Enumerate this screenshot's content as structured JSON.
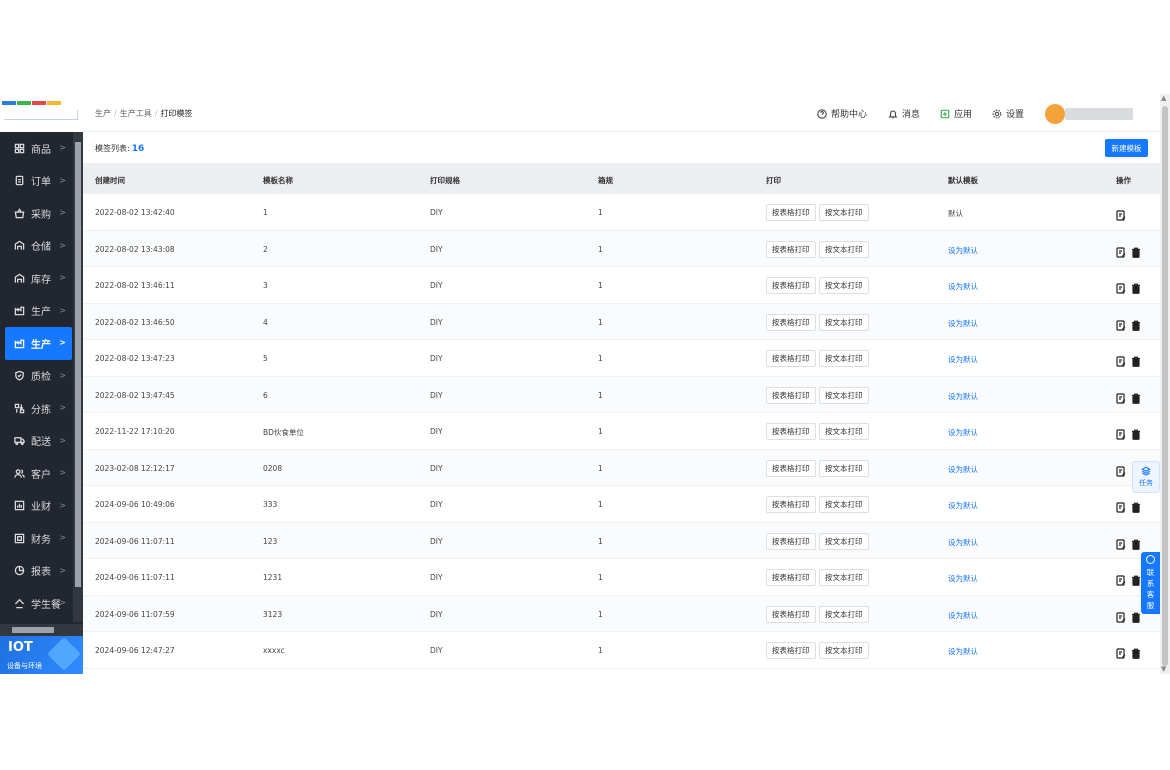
{
  "sidebar": {
    "items": [
      {
        "label": "商品",
        "icon": "grid-icon"
      },
      {
        "label": "订单",
        "icon": "order-icon"
      },
      {
        "label": "采购",
        "icon": "basket-icon"
      },
      {
        "label": "仓储",
        "icon": "warehouse-icon"
      },
      {
        "label": "库存",
        "icon": "warehouse-icon"
      },
      {
        "label": "生产",
        "icon": "factory-icon"
      },
      {
        "label": "生产",
        "icon": "factory-icon",
        "active": true
      },
      {
        "label": "质检",
        "icon": "shield-icon"
      },
      {
        "label": "分拣",
        "icon": "sort-icon"
      },
      {
        "label": "配送",
        "icon": "truck-icon"
      },
      {
        "label": "客户",
        "icon": "users-icon"
      },
      {
        "label": "业财",
        "icon": "chart-icon"
      },
      {
        "label": "财务",
        "icon": "finance-icon"
      },
      {
        "label": "报表",
        "icon": "pie-icon"
      },
      {
        "label": "学生餐",
        "icon": "home-icon"
      }
    ],
    "iot_title": "IOT",
    "iot_subtitle": "设备与环境"
  },
  "header": {
    "breadcrumb": [
      "生产",
      "生产工具",
      "打印模签"
    ],
    "help": "帮助中心",
    "messages": "消息",
    "apps": "应用",
    "settings": "设置"
  },
  "list": {
    "title": "模签列表:",
    "count": "16",
    "new_button": "新建模板",
    "columns": [
      "创建时间",
      "模板名称",
      "打印规格",
      "箱规",
      "打印",
      "默认模板",
      "操作"
    ],
    "print_table_label": "按表格打印",
    "print_text_label": "按文本打印",
    "rows": [
      {
        "created": "2022-08-02 13:42:40",
        "name": "1",
        "spec": "DIY",
        "box": "1",
        "default": "默认",
        "is_default": true
      },
      {
        "created": "2022-08-02 13:43:08",
        "name": "2",
        "spec": "DIY",
        "box": "1",
        "default": "设为默认"
      },
      {
        "created": "2022-08-02 13:46:11",
        "name": "3",
        "spec": "DIY",
        "box": "1",
        "default": "设为默认"
      },
      {
        "created": "2022-08-02 13:46:50",
        "name": "4",
        "spec": "DIY",
        "box": "1",
        "default": "设为默认"
      },
      {
        "created": "2022-08-02 13:47:23",
        "name": "5",
        "spec": "DIY",
        "box": "1",
        "default": "设为默认"
      },
      {
        "created": "2022-08-02 13:47:45",
        "name": "6",
        "spec": "DIY",
        "box": "1",
        "default": "设为默认"
      },
      {
        "created": "2022-11-22 17:10:20",
        "name": "BD伙食单位",
        "spec": "DIY",
        "box": "1",
        "default": "设为默认"
      },
      {
        "created": "2023-02-08 12:12:17",
        "name": "0208",
        "spec": "DIY",
        "box": "1",
        "default": "设为默认"
      },
      {
        "created": "2024-09-06 10:49:06",
        "name": "333",
        "spec": "DIY",
        "box": "1",
        "default": "设为默认"
      },
      {
        "created": "2024-09-06 11:07:11",
        "name": "123",
        "spec": "DIY",
        "box": "1",
        "default": "设为默认"
      },
      {
        "created": "2024-09-06 11:07:11",
        "name": "1231",
        "spec": "DIY",
        "box": "1",
        "default": "设为默认"
      },
      {
        "created": "2024-09-06 11:07:59",
        "name": "3123",
        "spec": "DIY",
        "box": "1",
        "default": "设为默认"
      },
      {
        "created": "2024-09-06 12:47:27",
        "name": "xxxxc",
        "spec": "DIY",
        "box": "1",
        "default": "设为默认"
      }
    ]
  },
  "floating": {
    "task": "任务",
    "support": [
      "联",
      "系",
      "客",
      "服"
    ]
  },
  "colors": {
    "accent": "#1677ff",
    "sidebar_bg": "#22262e"
  }
}
